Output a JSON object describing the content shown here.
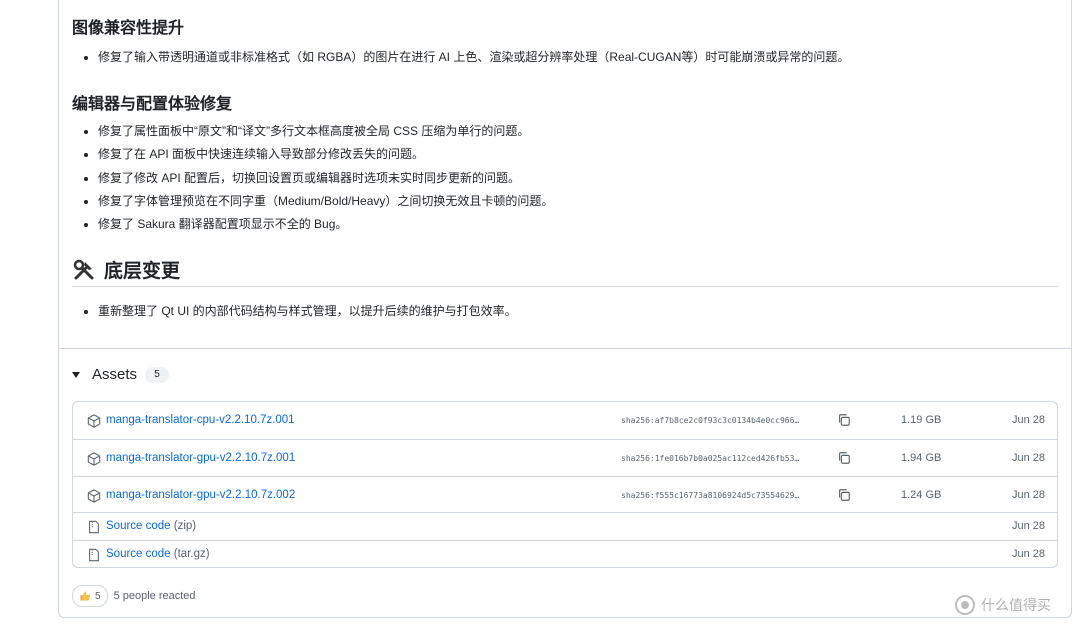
{
  "sections": {
    "compat": {
      "title": "图像兼容性提升",
      "items": [
        "修复了输入带透明通道或非标准格式（如 RGBA）的图片在进行 AI 上色、渲染或超分辨率处理（Real-CUGAN等）时可能崩溃或异常的问题。"
      ]
    },
    "editor": {
      "title": "编辑器与配置体验修复",
      "items": [
        "修复了属性面板中“原文”和“译文”多行文本框高度被全局 CSS 压缩为单行的问题。",
        "修复了在 API 面板中快速连续输入导致部分修改丢失的问题。",
        "修复了修改 API 配置后，切换回设置页或编辑器时选项未实时同步更新的问题。",
        "修复了字体管理预览在不同字重（Medium/Bold/Heavy）之间切换无效且卡顿的问题。",
        "修复了 Sakura 翻译器配置项显示不全的 Bug。"
      ]
    },
    "lowlevel": {
      "title": "底层变更",
      "icon": "tools-icon",
      "items": [
        "重新整理了 Qt UI 的内部代码结构与样式管理，以提升后续的维护与打包效率。"
      ]
    }
  },
  "assets": {
    "label": "Assets",
    "count": "5",
    "rows": [
      {
        "name": "manga-translator-cpu-v2.2.10.7z.001",
        "sub": "",
        "sha": "sha256:af7b8ce2c0f93c3c0134b4e0cc966…",
        "size": "1.19 GB",
        "date": "Jun 28",
        "icon": "package-icon"
      },
      {
        "name": "manga-translator-gpu-v2.2.10.7z.001",
        "sub": "",
        "sha": "sha256:1fe016b7b0a025ac112ced426fb53…",
        "size": "1.94 GB",
        "date": "Jun 28",
        "icon": "package-icon"
      },
      {
        "name": "manga-translator-gpu-v2.2.10.7z.002",
        "sub": "",
        "sha": "sha256:f555c16773a8106924d5c73554629…",
        "size": "1.24 GB",
        "date": "Jun 28",
        "icon": "package-icon"
      },
      {
        "name": "Source code",
        "sub": "(zip)",
        "sha": "",
        "size": "",
        "date": "Jun 28",
        "icon": "file-zip-icon"
      },
      {
        "name": "Source code",
        "sub": "(tar.gz)",
        "sha": "",
        "size": "",
        "date": "Jun 28",
        "icon": "file-zip-icon"
      }
    ]
  },
  "reactions": {
    "emoji": "thumbs-up-icon",
    "count": "5",
    "text": "5 people reacted"
  },
  "watermark": {
    "text": "什么值得买"
  },
  "colors": {
    "link": "#0969da",
    "muted": "#59636e",
    "border": "#d0d7de"
  }
}
